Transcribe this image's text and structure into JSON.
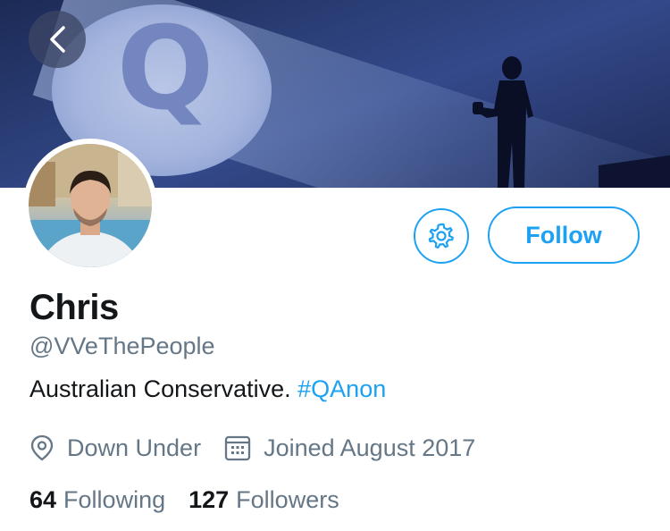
{
  "banner": {
    "logo_letter": "Q"
  },
  "profile": {
    "display_name": "Chris",
    "handle": "@VVeThePeople",
    "bio_text": "Australian Conservative.",
    "bio_hashtag": "#QAnon",
    "location": "Down Under",
    "joined": "Joined August 2017"
  },
  "actions": {
    "follow_label": "Follow"
  },
  "stats": {
    "following_count": "64",
    "following_label": "Following",
    "followers_count": "127",
    "followers_label": "Followers"
  },
  "icons": {
    "back": "chevron-left-icon",
    "settings": "gear-icon",
    "location": "location-pin-icon",
    "joined": "calendar-icon"
  },
  "colors": {
    "accent": "#1da1f2",
    "secondary_text": "#657786",
    "primary_text": "#14171a"
  }
}
